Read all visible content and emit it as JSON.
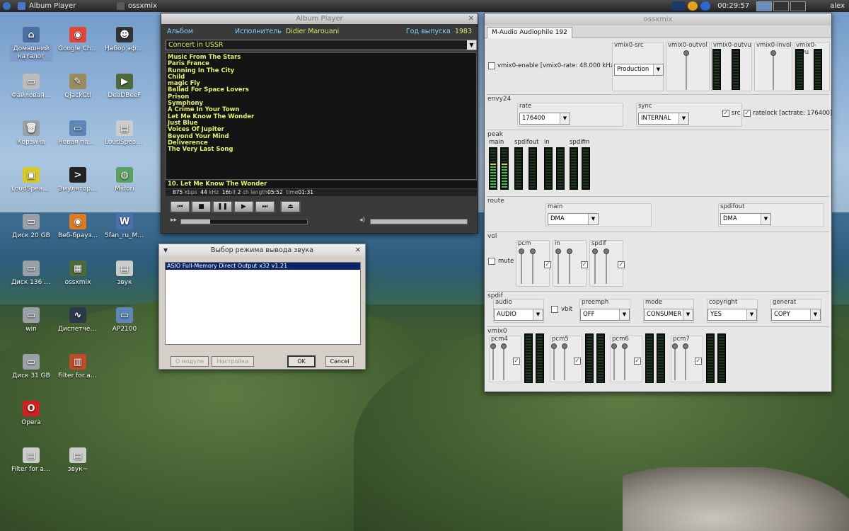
{
  "taskbar": {
    "items": [
      {
        "label": "Album Player",
        "icon": "album-player-icon",
        "color": "#4a78c8"
      },
      {
        "label": "ossxmix",
        "icon": "ossxmix-icon",
        "color": "#5a5a5a"
      }
    ],
    "clock": "00:29:57",
    "user": "alex"
  },
  "desktop": [
    {
      "label": "Домашний каталог",
      "icon": "home-folder-icon",
      "color": "#4a6fa0",
      "glyph": "⌂",
      "selected": true
    },
    {
      "label": "Google Chr...",
      "icon": "chrome-icon",
      "color": "#e0463a",
      "glyph": "◉"
    },
    {
      "label": "Набор эфф...",
      "icon": "panda-icon",
      "color": "#333333",
      "glyph": "☻"
    },
    {
      "label": "Файловая ...",
      "icon": "drive-icon",
      "color": "#bcbcbc",
      "glyph": "▭"
    },
    {
      "label": "QjackCtl",
      "icon": "qjackctl-icon",
      "color": "#9a8a60",
      "glyph": "✎"
    },
    {
      "label": "DeaDBeeF",
      "icon": "deadbeef-icon",
      "color": "#4e6a3a",
      "glyph": "▶"
    },
    {
      "label": "Корзина",
      "icon": "trash-icon",
      "color": "#9aa0a8",
      "glyph": "🗑"
    },
    {
      "label": "Новая папка",
      "icon": "folder-icon",
      "color": "#5f86b8",
      "glyph": "▭"
    },
    {
      "label": "LoudSpeak...",
      "icon": "file-icon",
      "color": "#cccccc",
      "glyph": "▤"
    },
    {
      "label": "LoudSpeak...",
      "icon": "loudspeaker-icon",
      "color": "#d8c820",
      "glyph": "▣"
    },
    {
      "label": "Эмулятор ...",
      "icon": "terminal-icon",
      "color": "#222222",
      "glyph": ">"
    },
    {
      "label": "Midori",
      "icon": "midori-icon",
      "color": "#5aa060",
      "glyph": "◍"
    },
    {
      "label": "Диск 20 GB",
      "icon": "disk-icon",
      "color": "#9aa0a8",
      "glyph": "▭"
    },
    {
      "label": "Веб-брауз...",
      "icon": "firefox-icon",
      "color": "#e07a20",
      "glyph": "◉"
    },
    {
      "label": "5fan_ru_Me...",
      "icon": "word-doc-icon",
      "color": "#4a70b0",
      "glyph": "W"
    },
    {
      "label": "Диск 136 GB",
      "icon": "disk-icon",
      "color": "#9aa0a8",
      "glyph": "▭"
    },
    {
      "label": "ossxmix",
      "icon": "ossxmix-app-icon",
      "color": "#4d6a3a",
      "glyph": "▦"
    },
    {
      "label": "звук",
      "icon": "file-icon",
      "color": "#cccccc",
      "glyph": "▤"
    },
    {
      "label": "win",
      "icon": "disk-icon",
      "color": "#9aa0a8",
      "glyph": "▭"
    },
    {
      "label": "Диспетчер...",
      "icon": "task-manager-icon",
      "color": "#2a3a4a",
      "glyph": "∿"
    },
    {
      "label": "AP2100",
      "icon": "folder-icon",
      "color": "#5f86b8",
      "glyph": "▭"
    },
    {
      "label": "Диск 31 GB",
      "icon": "disk-icon",
      "color": "#9aa0a8",
      "glyph": "▭"
    },
    {
      "label": "Filter for ac...",
      "icon": "filter-app-icon",
      "color": "#c04a2a",
      "glyph": "▥"
    },
    {
      "label": "Opera",
      "icon": "opera-icon",
      "color": "#d02020",
      "glyph": "O"
    },
    {
      "label": "Filter for ac...",
      "icon": "file-icon",
      "color": "#cccccc",
      "glyph": "▤"
    },
    {
      "label": "звук~",
      "icon": "file-icon",
      "color": "#cccccc",
      "glyph": "▤"
    }
  ],
  "album_player": {
    "title": "Album Player",
    "album_label": "Альбом",
    "artist_label": "Исполнитель",
    "artist": "Didier Marouani",
    "year_label": "Год выпуска",
    "year": "1983",
    "album": "Concert in USSR",
    "tracks": [
      "Music From The Stars",
      "Paris France",
      "Running In The City",
      "Child",
      "magic Fly",
      "Ballad For Space Lovers",
      "Prison",
      "Symphony",
      "A Crime In Your Town",
      "Let Me Know The Wonder",
      "Just Blue",
      "Voices Of Jupiter",
      "Beyond Your Mind",
      "Deliverence",
      "The Very Last Song"
    ],
    "now_playing": "10.  Let Me Know The Wonder",
    "info": {
      "kbps": "875",
      "kbps_unit": "kbps",
      "khz": "44",
      "khz_unit": "kHz",
      "bit": "16",
      "bit_unit": "bit",
      "ch": "2",
      "ch_unit": "ch",
      "length_label": "length",
      "length": "05:52",
      "time_label": "time",
      "time": "01:31"
    },
    "progress": 0.23
  },
  "dialog": {
    "title": "Выбор режима вывода звука",
    "items": [
      "ASIO Full-Memory Direct Output x32 v1.21"
    ],
    "about": "О модуле",
    "settings": "Настройка",
    "ok": "OK",
    "cancel": "Cancel"
  },
  "ossxmix": {
    "title": "ossxmix",
    "tab": "M-Audio Audiophile 192",
    "vmix_src_label": "vmix0-src",
    "vmix_src_value": "Production",
    "outvol_label": "vmix0-outvol",
    "outvu_label": "vmix0-outvu",
    "invol_label": "vmix0-invol",
    "invu_label": "vmix0-invu",
    "enable_label": "vmix0-enable [vmix0-rate: 48.000 kHz]",
    "envy24": "envy24",
    "rate_label": "rate",
    "rate_value": "176400",
    "sync_label": "sync",
    "sync_value": "INTERNAL",
    "src_label": "src",
    "ratelock_label": "ratelock [actrate: 176400]",
    "peak": "peak",
    "peak_main": "main",
    "peak_spdifout": "spdifout",
    "peak_in": "in",
    "peak_spdifin": "spdifin",
    "route": "route",
    "route_main_label": "main",
    "route_main_value": "DMA",
    "route_spdifout_label": "spdifout",
    "route_spdifout_value": "DMA",
    "vol": "vol",
    "mute_label": "mute",
    "vol_pcm": "pcm",
    "vol_in": "in",
    "vol_spdif": "spdif",
    "spdif": "spdif",
    "audio_label": "audio",
    "audio_value": "AUDIO",
    "vbit_label": "vbit",
    "preemph_label": "preemph",
    "preemph_value": "OFF",
    "mode_label": "mode",
    "mode_value": "CONSUMER",
    "copyright_label": "copyright",
    "copyright_value": "YES",
    "generat_label": "generat",
    "generat_value": "COPY",
    "vmix0": "vmix0",
    "pcm4": "pcm4",
    "pcm5": "pcm5",
    "pcm6": "pcm6",
    "pcm7": "pcm7"
  }
}
